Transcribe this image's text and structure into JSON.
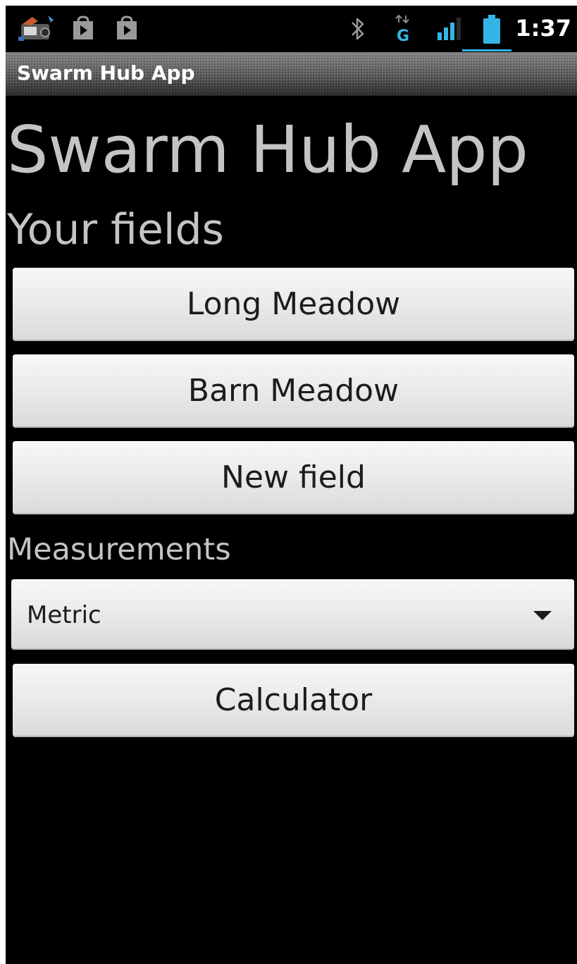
{
  "status_bar": {
    "time": "1:37",
    "notification_icons": [
      "notification-app-icon",
      "market-download-icon",
      "market-download-icon"
    ],
    "system_icons": [
      "bluetooth-icon",
      "data-g-icon",
      "signal-icon",
      "battery-icon"
    ],
    "accent_color": "#33b5e5"
  },
  "title_bar": {
    "title": "Swarm Hub App"
  },
  "main": {
    "heading": "Swarm Hub App",
    "fields_label": "Your fields",
    "fields": [
      {
        "label": "Long Meadow"
      },
      {
        "label": "Barn Meadow"
      }
    ],
    "new_field_label": "New field",
    "measurements_label": "Measurements",
    "measurements_selected": "Metric",
    "calculator_label": "Calculator"
  }
}
